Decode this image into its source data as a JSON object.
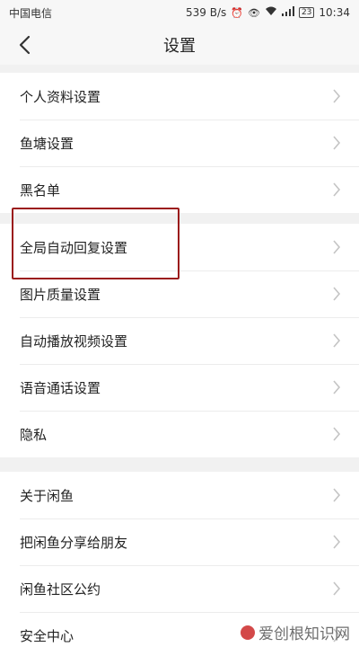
{
  "status_bar": {
    "carrier": "中国电信",
    "net_speed": "539 B/s",
    "battery_level": "23",
    "time": "10:34",
    "icons": [
      "alarm-icon",
      "eye-icon",
      "wifi-icon",
      "signal-4g-icon",
      "battery-icon"
    ]
  },
  "header": {
    "title": "设置",
    "back_icon": "chevron-left-icon"
  },
  "sections": [
    {
      "items": [
        {
          "label": "个人资料设置"
        },
        {
          "label": "鱼塘设置"
        },
        {
          "label": "黑名单"
        }
      ]
    },
    {
      "items": [
        {
          "label": "全局自动回复设置"
        },
        {
          "label": "图片质量设置"
        },
        {
          "label": "自动播放视频设置"
        },
        {
          "label": "语音通话设置"
        },
        {
          "label": "隐私"
        }
      ]
    },
    {
      "items": [
        {
          "label": "关于闲鱼"
        },
        {
          "label": "把闲鱼分享给朋友"
        },
        {
          "label": "闲鱼社区公约"
        },
        {
          "label": "安全中心"
        }
      ]
    }
  ],
  "highlight": {
    "target": "全局自动回复设置",
    "color": "#9b1b1b"
  },
  "watermark": {
    "text": "爱创根知识网"
  }
}
